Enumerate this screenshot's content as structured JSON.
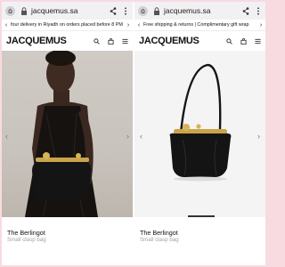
{
  "browser": {
    "url": "jacquemus.sa"
  },
  "panes": [
    {
      "promo": "four delivery in Riyadh on orders placed before 8 PM",
      "brand": "JACQUEMUS",
      "product": {
        "name": "The Berlingot",
        "subtitle": "Small clasp bag"
      }
    },
    {
      "promo": "Free shipping & returns | Complimentary gift wrap",
      "brand": "JACQUEMUS",
      "product": {
        "name": "The Berlingot",
        "subtitle": "Small clasp bag"
      }
    }
  ],
  "colors": {
    "frame": "#f7dbe0",
    "bag": "#141414",
    "clasp": "#c9a44a"
  },
  "icons": [
    "home-icon",
    "lock-icon",
    "share-icon",
    "more-icon",
    "search-icon",
    "bag-icon",
    "menu-icon",
    "arrow-left-icon",
    "arrow-right-icon"
  ]
}
